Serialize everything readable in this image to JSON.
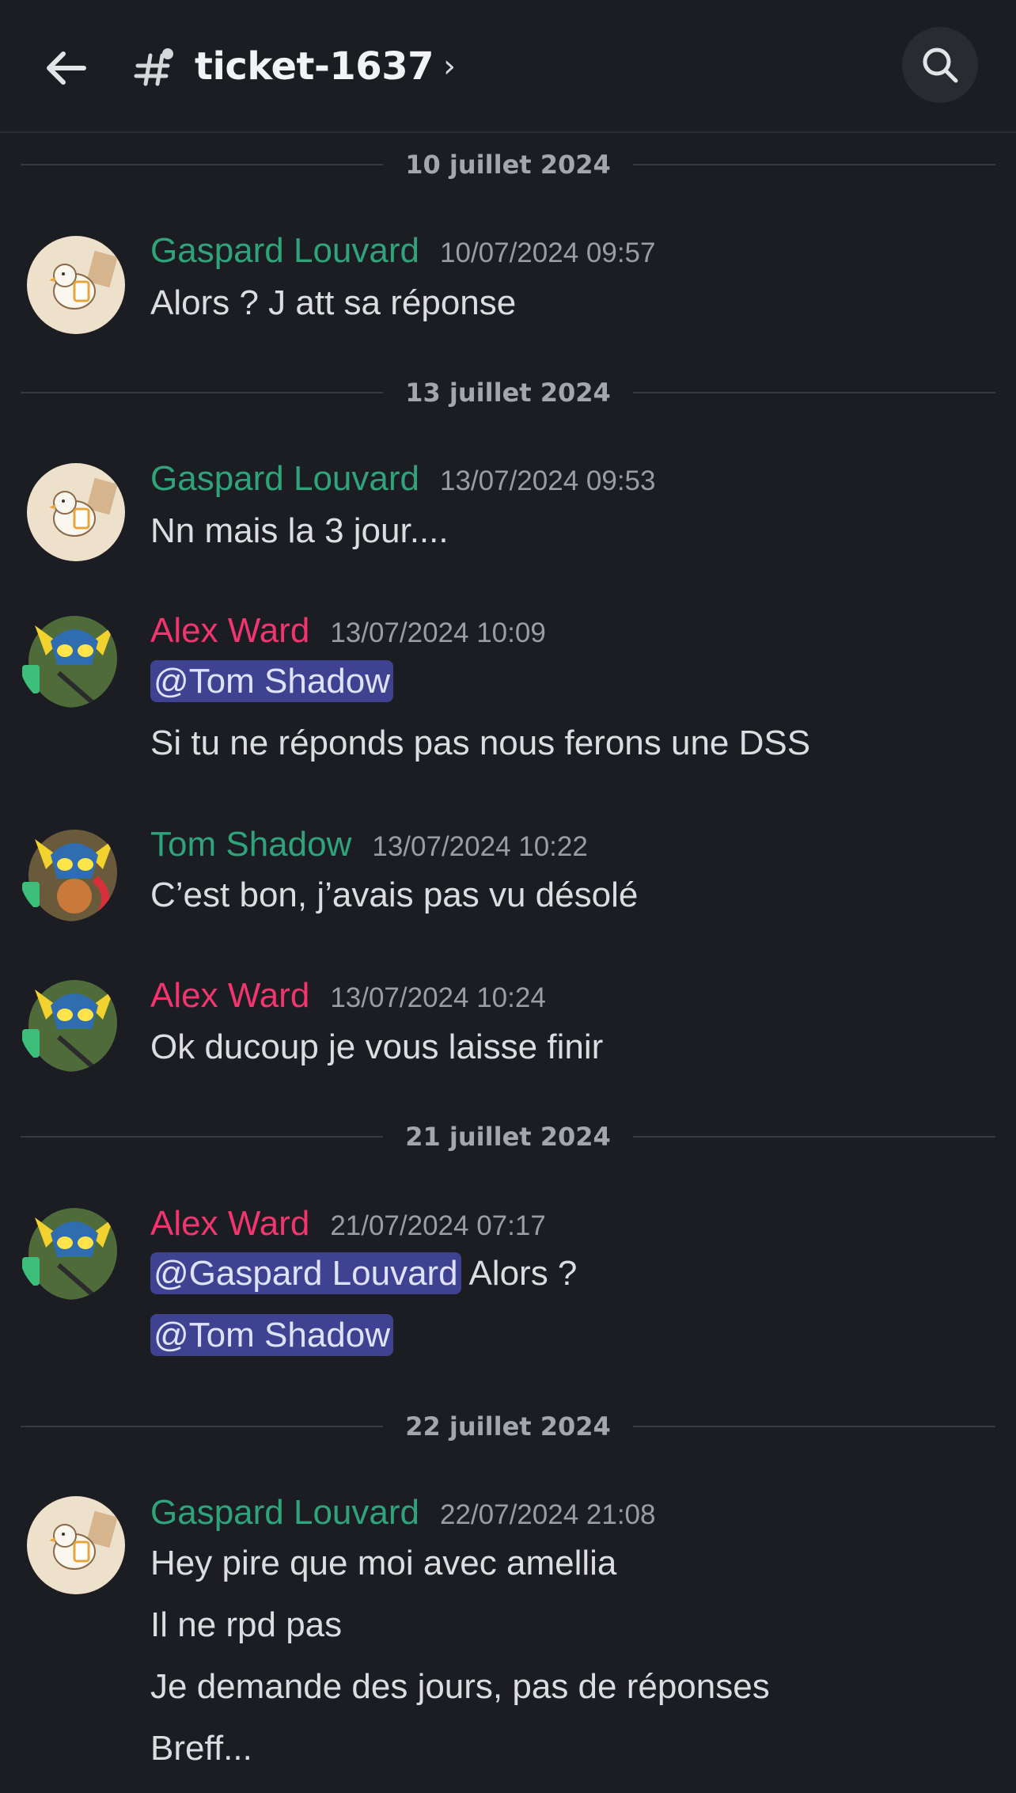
{
  "header": {
    "channel_name": "ticket-1637",
    "chevron": "›",
    "back_icon": "arrow-left-icon",
    "channel_icon": "thread-hash-icon",
    "search_icon": "search-icon"
  },
  "colors": {
    "background": "#1c1d22",
    "author_green": "#2fa37a",
    "author_pink": "#f0356f",
    "mention_bg": "#3e4290",
    "timestamp": "#9a9da5",
    "separator_text": "#a3a6ad"
  },
  "separators": [
    "10 juillet 2024",
    "13 juillet 2024",
    "21 juillet 2024",
    "22 juillet 2024"
  ],
  "messages": [
    {
      "author": "Gaspard Louvard",
      "timestamp": "10/07/2024 09:57",
      "lines": [
        "Alors ? J att sa réponse"
      ]
    },
    {
      "author": "Gaspard Louvard",
      "timestamp": "13/07/2024 09:53",
      "lines": [
        "Nn mais la 3 jour...."
      ]
    },
    {
      "author": "Alex Ward",
      "timestamp": "13/07/2024 10:09",
      "mention": "@Tom Shadow",
      "lines": [
        "Si tu ne réponds pas nous ferons une DSS"
      ]
    },
    {
      "author": "Tom Shadow",
      "timestamp": "13/07/2024 10:22",
      "lines": [
        "C’est bon, j’avais pas vu désolé"
      ]
    },
    {
      "author": "Alex Ward",
      "timestamp": "13/07/2024 10:24",
      "lines": [
        "Ok ducoup je vous laisse finir"
      ]
    },
    {
      "author": "Alex Ward",
      "timestamp": "21/07/2024 07:17",
      "mention1": "@Gaspard Louvard",
      "after_mention1": " Alors ?",
      "mention2": "@Tom Shadow"
    },
    {
      "author": "Gaspard Louvard",
      "timestamp": "22/07/2024 21:08",
      "lines": [
        "Hey pire que moi avec amellia",
        "Il ne rpd pas",
        "Je demande des jours,  pas de réponses",
        "Breff..."
      ]
    }
  ]
}
